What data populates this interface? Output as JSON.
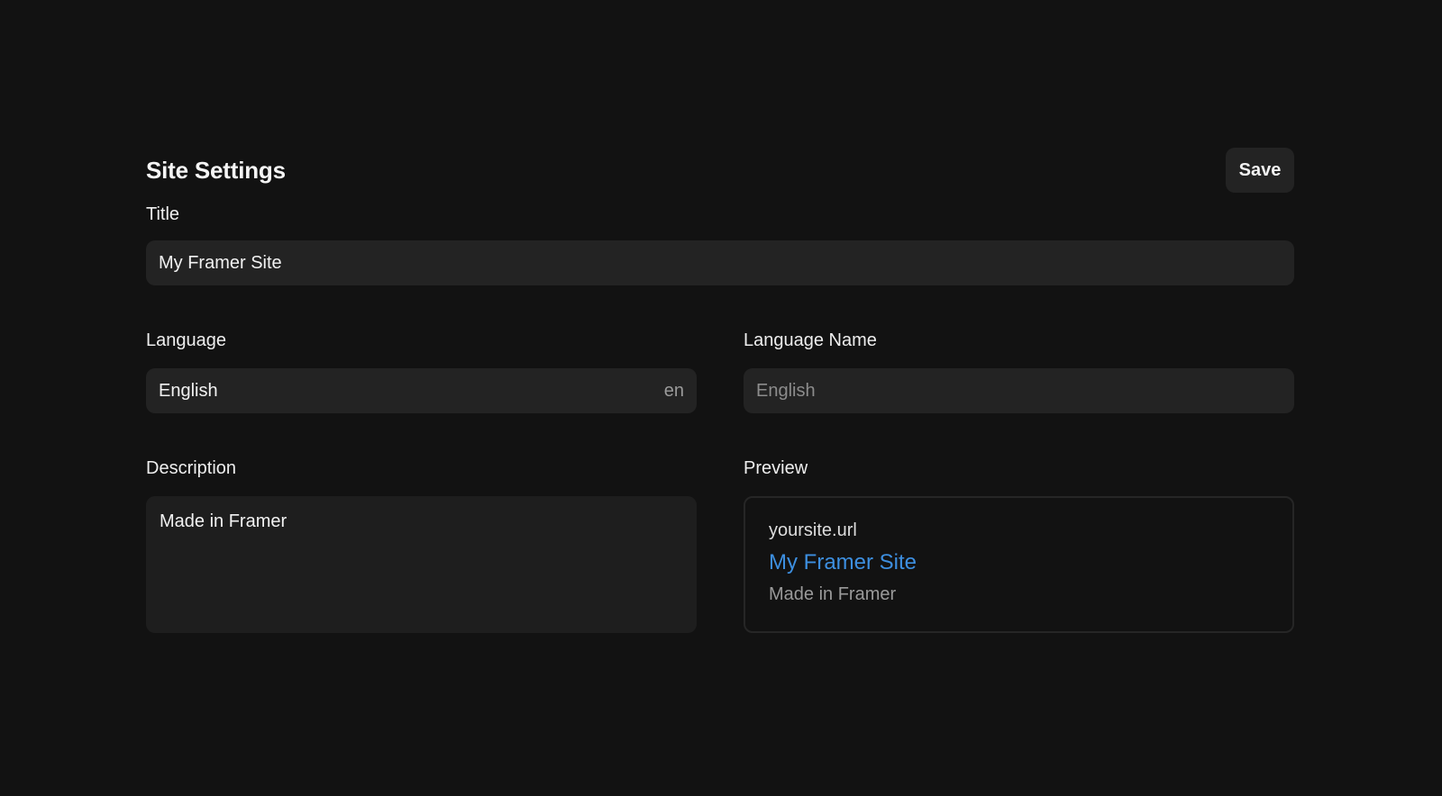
{
  "header": {
    "title": "Site Settings",
    "save_label": "Save"
  },
  "fields": {
    "title": {
      "label": "Title",
      "value": "My Framer Site"
    },
    "language": {
      "label": "Language",
      "value": "English",
      "code": "en"
    },
    "language_name": {
      "label": "Language Name",
      "placeholder": "English"
    },
    "description": {
      "label": "Description",
      "value": "Made in Framer"
    }
  },
  "preview": {
    "label": "Preview",
    "url": "yoursite.url",
    "title": "My Framer Site",
    "description": "Made in Framer"
  },
  "colors": {
    "background": "#121212",
    "input_background": "#232323",
    "preview_link": "#3d8fe0"
  }
}
